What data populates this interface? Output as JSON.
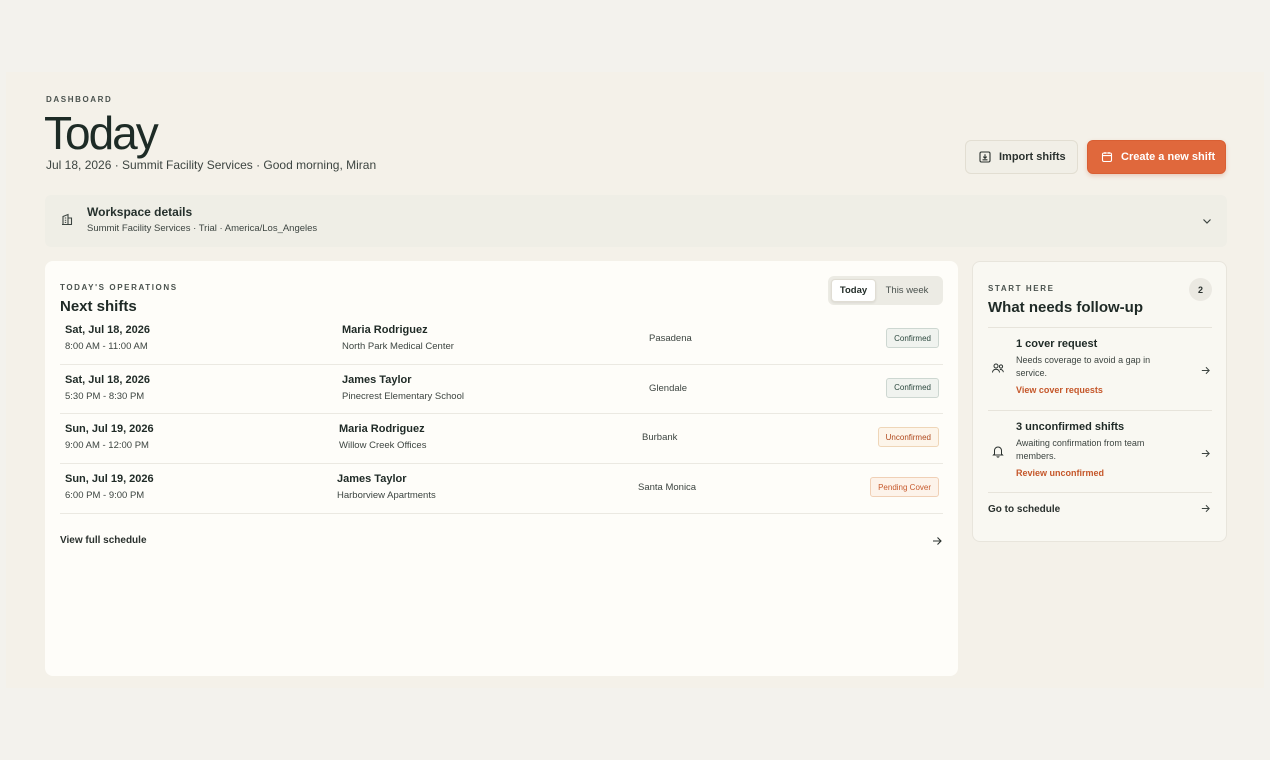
{
  "header": {
    "eyebrow": "DASHBOARD",
    "title": "Today",
    "subtitle": "Jul 18, 2026 · Summit Facility Services · Good morning, Miran"
  },
  "actions": {
    "import_label": "Import shifts",
    "create_label": "Create a new shift"
  },
  "workspace": {
    "title": "Workspace details",
    "subtitle": "Summit Facility Services · Trial · America/Los_Angeles"
  },
  "operations": {
    "eyebrow": "TODAY'S OPERATIONS",
    "title": "Next shifts",
    "tabs": [
      {
        "label": "Today",
        "active": true
      },
      {
        "label": "This week",
        "active": false
      }
    ],
    "shifts": [
      {
        "date": "Sat, Jul 18, 2026",
        "time": "8:00 AM - 11:00 AM",
        "person": "Maria Rodriguez",
        "site": "North Park Medical Center",
        "city": "Pasadena",
        "status": "Confirmed"
      },
      {
        "date": "Sat, Jul 18, 2026",
        "time": "5:30 PM - 8:30 PM",
        "person": "James Taylor",
        "site": "Pinecrest Elementary School",
        "city": "Glendale",
        "status": "Confirmed"
      },
      {
        "date": "Sun, Jul 19, 2026",
        "time": "9:00 AM - 12:00 PM",
        "person": "Maria Rodriguez",
        "site": "Willow Creek Offices",
        "city": "Burbank",
        "status": "Unconfirmed"
      },
      {
        "date": "Sun, Jul 19, 2026",
        "time": "6:00 PM - 9:00 PM",
        "person": "James Taylor",
        "site": "Harborview Apartments",
        "city": "Santa Monica",
        "status": "Pending Cover"
      }
    ],
    "view_all_label": "View full schedule"
  },
  "followup": {
    "eyebrow": "START HERE",
    "title": "What needs follow-up",
    "count": "2",
    "items": [
      {
        "title": "1 cover request",
        "desc": "Needs coverage to avoid a gap in service.",
        "link": "View cover requests",
        "icon": "users-icon"
      },
      {
        "title": "3 unconfirmed shifts",
        "desc": "Awaiting confirmation from team members.",
        "link": "Review unconfirmed",
        "icon": "bell-icon"
      }
    ],
    "goto_label": "Go to schedule"
  },
  "colors": {
    "accent": "#e0683c",
    "background": "#f3f2ed",
    "card": "#fefdf9"
  }
}
